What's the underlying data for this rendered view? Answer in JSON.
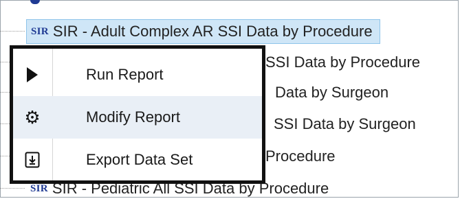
{
  "tree": {
    "rows": [
      {
        "badge": "SIR",
        "label": "SIR - Adult Complex AR SSI Data by Procedure",
        "selected": true
      },
      {
        "label_visible": "SSI Data by Procedure"
      },
      {
        "label_visible": "Data by Surgeon"
      },
      {
        "label_visible": "SSI Data by Surgeon"
      },
      {
        "label_visible": "Procedure"
      },
      {
        "badge": "SIR",
        "label": "SIR - Pediatric All SSI Data by Procedure"
      }
    ]
  },
  "context_menu": {
    "items": [
      {
        "icon": "play-icon",
        "label": "Run Report"
      },
      {
        "icon": "gear-icon",
        "label": "Modify Report"
      },
      {
        "icon": "export-icon",
        "label": "Export Data Set"
      }
    ]
  },
  "colors": {
    "selection_bg": "#cfe6f7",
    "selection_border": "#8ec4ea",
    "badge": "#1f3a93",
    "menu_border": "#111111",
    "menu_hover": "#e9eff6"
  }
}
